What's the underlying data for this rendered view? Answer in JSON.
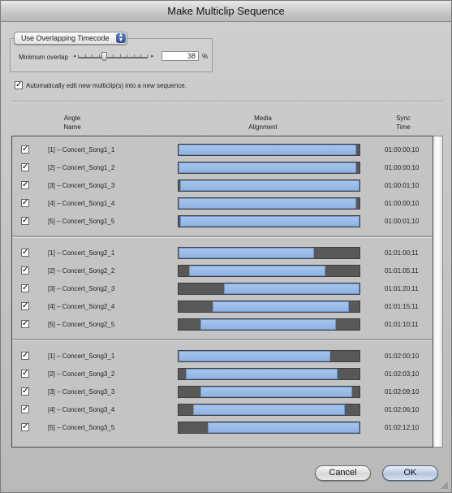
{
  "window": {
    "title": "Make Multiclip Sequence"
  },
  "overlap": {
    "mode": "Use Overlapping Timecode",
    "label": "Minimum overlap",
    "value": "38",
    "unit": "%",
    "level_percent": 38
  },
  "auto_edit": {
    "label": "Automatically edit new multiclip(s) into a new sequence.",
    "checked": true
  },
  "headers": {
    "angle": [
      "Angle",
      "Name"
    ],
    "media": [
      "Media",
      "Alignment"
    ],
    "sync": [
      "Sync",
      "Time"
    ]
  },
  "groups": [
    {
      "rows": [
        {
          "name": "[1] – Concert_Song1_1",
          "time": "01:00:00;10",
          "fill": [
            0,
            98
          ]
        },
        {
          "name": "[2] – Concert_Song1_2",
          "time": "01:00:00;10",
          "fill": [
            0,
            98
          ]
        },
        {
          "name": "[3] – Concert_Song1_3",
          "time": "01:00:01;10",
          "fill": [
            1,
            100
          ]
        },
        {
          "name": "[4] – Concert_Song1_4",
          "time": "01:00:00;10",
          "fill": [
            0,
            98
          ]
        },
        {
          "name": "[5] – Concert_Song1_5",
          "time": "01:00:01;10",
          "fill": [
            1,
            100
          ]
        }
      ]
    },
    {
      "rows": [
        {
          "name": "[1] – Concert_Song2_1",
          "time": "01:01:00;11",
          "fill": [
            0,
            75
          ]
        },
        {
          "name": "[2] – Concert_Song2_2",
          "time": "01:01:05;11",
          "fill": [
            6,
            81
          ]
        },
        {
          "name": "[3] – Concert_Song2_3",
          "time": "01:01:20;11",
          "fill": [
            25,
            100
          ]
        },
        {
          "name": "[4] – Concert_Song2_4",
          "time": "01:01:15;11",
          "fill": [
            19,
            94
          ]
        },
        {
          "name": "[5] – Concert_Song2_5",
          "time": "01:01:10;11",
          "fill": [
            12,
            87
          ]
        }
      ]
    },
    {
      "rows": [
        {
          "name": "[1] – Concert_Song3_1",
          "time": "01:02:00;10",
          "fill": [
            0,
            84
          ]
        },
        {
          "name": "[2] – Concert_Song3_2",
          "time": "01:02:03;10",
          "fill": [
            4,
            88
          ]
        },
        {
          "name": "[3] – Concert_Song3_3",
          "time": "01:02:09;10",
          "fill": [
            12,
            96
          ]
        },
        {
          "name": "[4] – Concert_Song3_4",
          "time": "01:02:06;10",
          "fill": [
            8,
            92
          ]
        },
        {
          "name": "[5] – Concert_Song3_5",
          "time": "01:02:12;10",
          "fill": [
            16,
            100
          ]
        }
      ]
    }
  ],
  "buttons": {
    "cancel": "Cancel",
    "ok": "OK"
  }
}
